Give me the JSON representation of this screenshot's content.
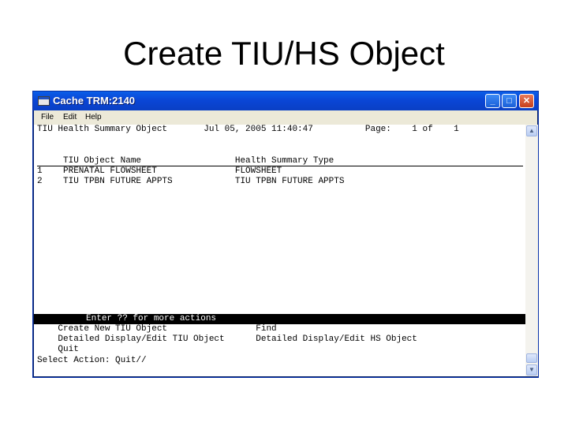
{
  "slide": {
    "title": "Create TIU/HS Object"
  },
  "window": {
    "title": "Cache TRM:2140",
    "minimize": "_",
    "maximize": "□",
    "close": "✕"
  },
  "menu": {
    "file": "File",
    "edit": "Edit",
    "help": "Help"
  },
  "terminal": {
    "header_line": "TIU Health Summary Object       Jul 05, 2005 11:40:47          Page:    1 of    1",
    "column_header": "     TIU Object Name                  Health Summary Type",
    "rows": [
      "1    PRENATAL FLOWSHEET               FLOWSHEET",
      "2    TIU TPBN FUTURE APPTS            TIU TPBN FUTURE APPTS"
    ],
    "action_hint": "          Enter ?? for more actions",
    "actions": [
      "    Create New TIU Object                 Find",
      "    Detailed Display/Edit TIU Object      Detailed Display/Edit HS Object",
      "    Quit"
    ],
    "prompt": "Select Action: Quit//"
  },
  "scroll": {
    "up": "▲",
    "down": "▼"
  }
}
